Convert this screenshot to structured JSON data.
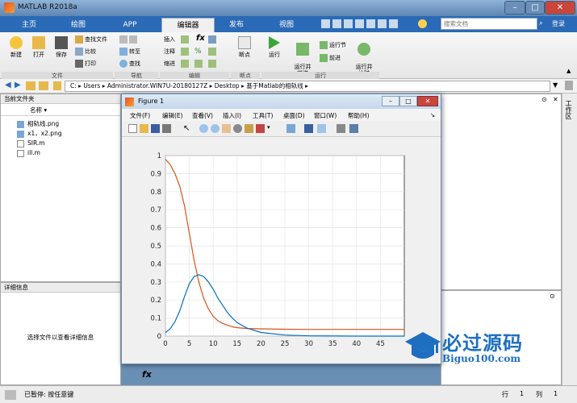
{
  "app": {
    "title": "MATLAB R2018a"
  },
  "tabs": [
    {
      "label": "主页"
    },
    {
      "label": "绘图"
    },
    {
      "label": "APP"
    },
    {
      "label": "编辑器"
    },
    {
      "label": "发布"
    },
    {
      "label": "视图"
    }
  ],
  "search": {
    "placeholder": "搜索文档",
    "login_label": "登录"
  },
  "toolstrip": {
    "file": {
      "group": "文件",
      "new": "新建",
      "open": "打开",
      "save": "保存",
      "find_files": "查找文件",
      "compare": "比较",
      "print": "打印"
    },
    "nav": {
      "group": "导航",
      "goto": "转至",
      "find": "查找"
    },
    "edit": {
      "group": "编辑",
      "insert": "插入",
      "comment": "注释",
      "indent": "缩进",
      "fx": "fx"
    },
    "breakpoints": {
      "group": "断点",
      "label": "断点"
    },
    "run": {
      "group": "运行",
      "run": "运行",
      "run_advance": "运行并\n前进",
      "run_section": "运行节",
      "advance": "前进",
      "run_time": "运行并\n计时"
    }
  },
  "address": {
    "segments": [
      "C:",
      "Users",
      "Administrator.WIN7U-20180127Z",
      "Desktop",
      "基于Matlab的相轨线"
    ]
  },
  "current_folder": {
    "title": "当前文件夹",
    "col_name": "名称",
    "files": [
      {
        "name": "相轨线.png",
        "type": "png"
      },
      {
        "name": "x1，x2.png",
        "type": "png"
      },
      {
        "name": "SIR.m",
        "type": "m"
      },
      {
        "name": "ill.m",
        "type": "m"
      }
    ]
  },
  "details": {
    "title": "详细信息",
    "hint": "选择文件以查看详细信息"
  },
  "right_panel": {
    "label": "工作区"
  },
  "figure": {
    "title": "Figure 1",
    "menu": [
      "文件(F)",
      "编辑(E)",
      "查看(V)",
      "插入(I)",
      "工具(T)",
      "桌面(D)",
      "窗口(W)",
      "帮助(H)"
    ]
  },
  "chart_data": {
    "type": "line",
    "title": "",
    "xlabel": "",
    "ylabel": "",
    "xlim": [
      0,
      50
    ],
    "ylim": [
      0,
      1
    ],
    "xticks": [
      0,
      5,
      10,
      15,
      20,
      25,
      30,
      35,
      40,
      45
    ],
    "yticks": [
      0,
      0.1,
      0.2,
      0.3,
      0.4,
      0.5,
      0.6,
      0.7,
      0.8,
      0.9,
      1
    ],
    "grid": true,
    "series": [
      {
        "color": "#d95319",
        "x": [
          0,
          1,
          2,
          3,
          4,
          5,
          6,
          7,
          8,
          9,
          10,
          11,
          12,
          13,
          14,
          15,
          17,
          20,
          25,
          30,
          40,
          50
        ],
        "y": [
          0.98,
          0.95,
          0.9,
          0.83,
          0.72,
          0.57,
          0.42,
          0.3,
          0.21,
          0.15,
          0.11,
          0.085,
          0.07,
          0.06,
          0.052,
          0.047,
          0.042,
          0.04,
          0.038,
          0.037,
          0.037,
          0.037
        ]
      },
      {
        "color": "#0072bd",
        "x": [
          0,
          1,
          2,
          3,
          4,
          5,
          6,
          7,
          8,
          9,
          10,
          11,
          12,
          13,
          14,
          15,
          17,
          20,
          25,
          30,
          40,
          50
        ],
        "y": [
          0.02,
          0.04,
          0.08,
          0.14,
          0.22,
          0.29,
          0.33,
          0.34,
          0.33,
          0.3,
          0.26,
          0.21,
          0.17,
          0.13,
          0.1,
          0.075,
          0.045,
          0.02,
          0.006,
          0.002,
          0.0,
          0.0
        ]
      }
    ]
  },
  "cmd": {
    "prompt": "fx"
  },
  "status": {
    "text": "已暂停: 按任意键",
    "row_label": "行",
    "row_value": "1",
    "col_label": "列",
    "col_value": "1"
  },
  "watermark": {
    "text": "必过源码",
    "url": "Biguo100.com"
  },
  "colors": {
    "accent": "#2a6ab6",
    "brand": "#1e6fc0"
  }
}
